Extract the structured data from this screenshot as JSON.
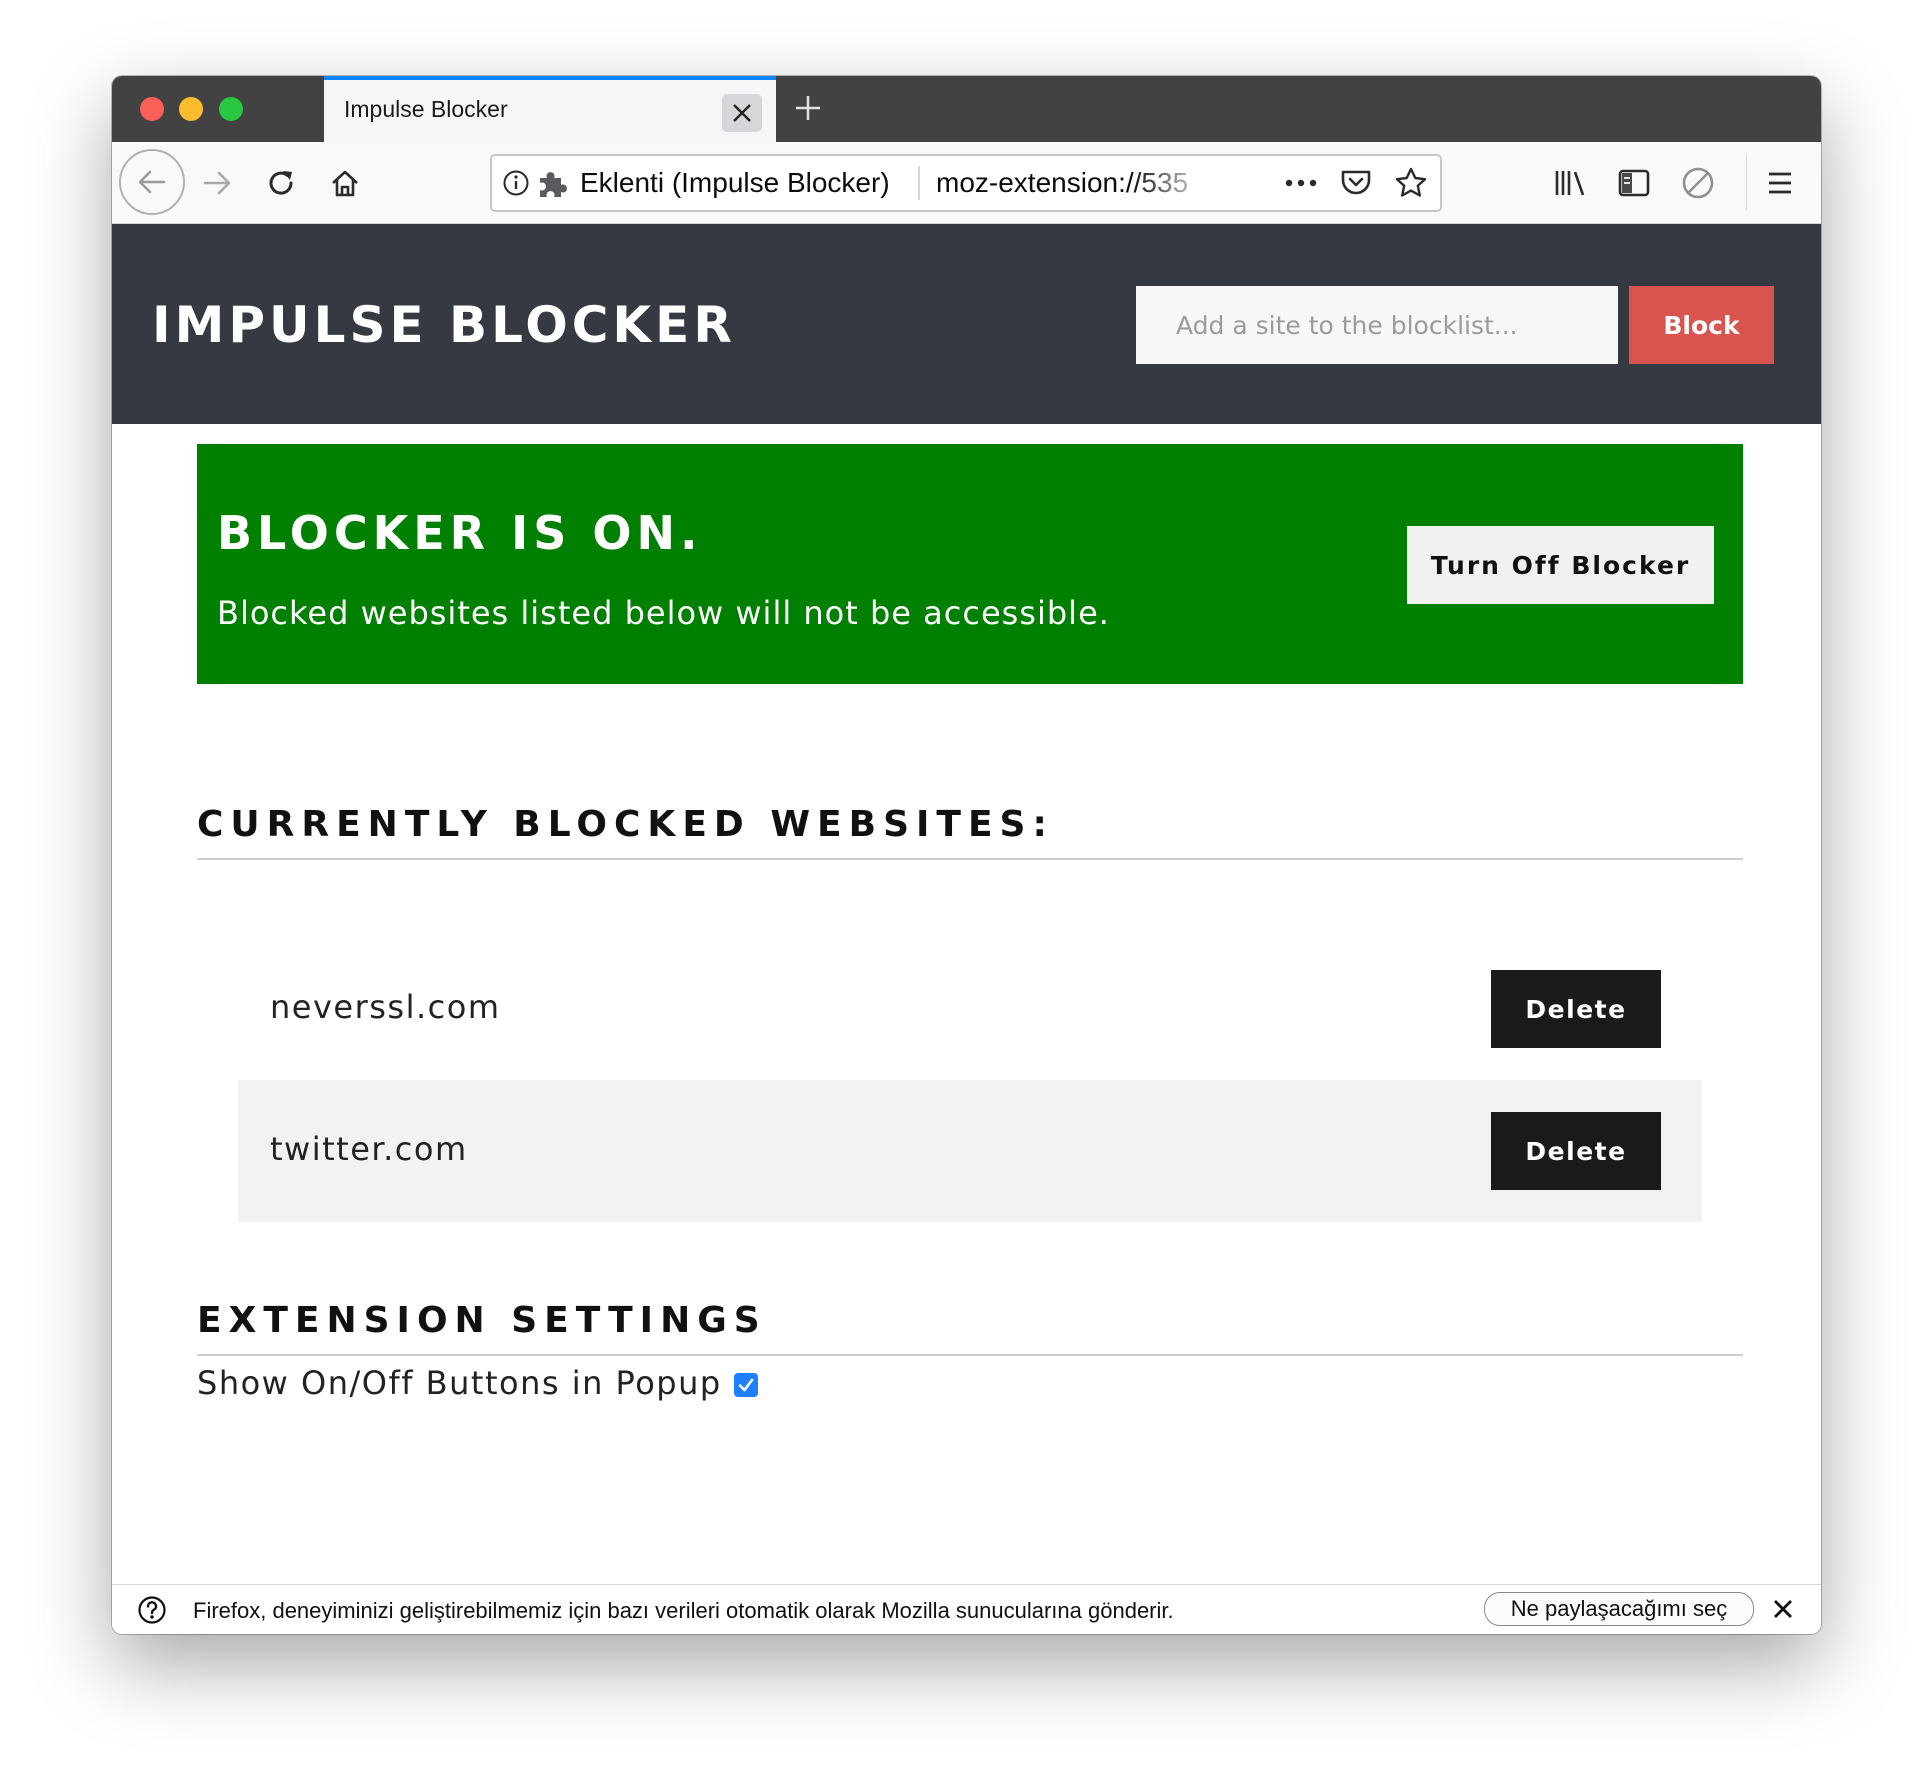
{
  "browser": {
    "tab_title": "Impulse Blocker",
    "identity_label": "Eklenti (Impulse Blocker)",
    "url": "moz-extension://535",
    "page_actions": [
      "page-actions-menu-icon",
      "pocket-icon",
      "bookmark-star-icon"
    ],
    "toolbar_icons": [
      "library-icon",
      "sidebar-icon",
      "blocked-icon",
      "hamburger-menu-icon"
    ]
  },
  "header": {
    "brand": "IMPULSE BLOCKER",
    "input_placeholder": "Add a site to the blocklist...",
    "block_label": "Block"
  },
  "status": {
    "title": "BLOCKER IS ON.",
    "subtitle": "Blocked websites listed below will not be accessible.",
    "toggle_label": "Turn Off Blocker",
    "color": "#008000"
  },
  "blocked_section": {
    "heading": "CURRENTLY BLOCKED WEBSITES:",
    "sites": [
      {
        "domain": "neverssl.com",
        "delete_label": "Delete"
      },
      {
        "domain": "twitter.com",
        "delete_label": "Delete"
      }
    ]
  },
  "settings_section": {
    "heading": "EXTENSION SETTINGS",
    "show_buttons_label": "Show On/Off Buttons in Popup",
    "show_buttons_checked": true
  },
  "notification": {
    "text": "Firefox, deneyiminizi geliştirebilmemiz için bazı verileri otomatik olarak Mozilla sunucularına gönderir.",
    "button_label": "Ne paylaşacağımı seç"
  },
  "colors": {
    "header_bg": "#353a42",
    "block_button": "#d9534f",
    "delete_button": "#1a1a1a",
    "accent_tab": "#0a84ff"
  }
}
